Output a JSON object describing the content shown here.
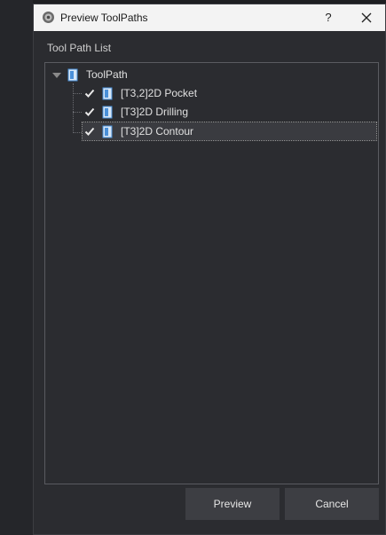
{
  "window": {
    "title": "Preview ToolPaths",
    "help_label": "?"
  },
  "toolpath_list": {
    "label": "Tool Path List",
    "root": {
      "label": "ToolPath",
      "expanded": true
    },
    "items": [
      {
        "label": "[T3,2]2D Pocket",
        "checked": true,
        "selected": false
      },
      {
        "label": "[T3]2D Drilling",
        "checked": true,
        "selected": false
      },
      {
        "label": "[T3]2D Contour",
        "checked": true,
        "selected": true
      }
    ]
  },
  "buttons": {
    "preview": "Preview",
    "cancel": "Cancel"
  },
  "icons": {
    "app": "app-icon",
    "close": "close-icon",
    "toolpath": "document-icon",
    "check": "check-icon",
    "expander": "triangle-down-icon"
  },
  "colors": {
    "dialog_bg": "#2b2c30",
    "titlebar_bg": "#f3f3f3",
    "button_bg": "#3d3e43",
    "icon_blue": "#4a90d9"
  }
}
